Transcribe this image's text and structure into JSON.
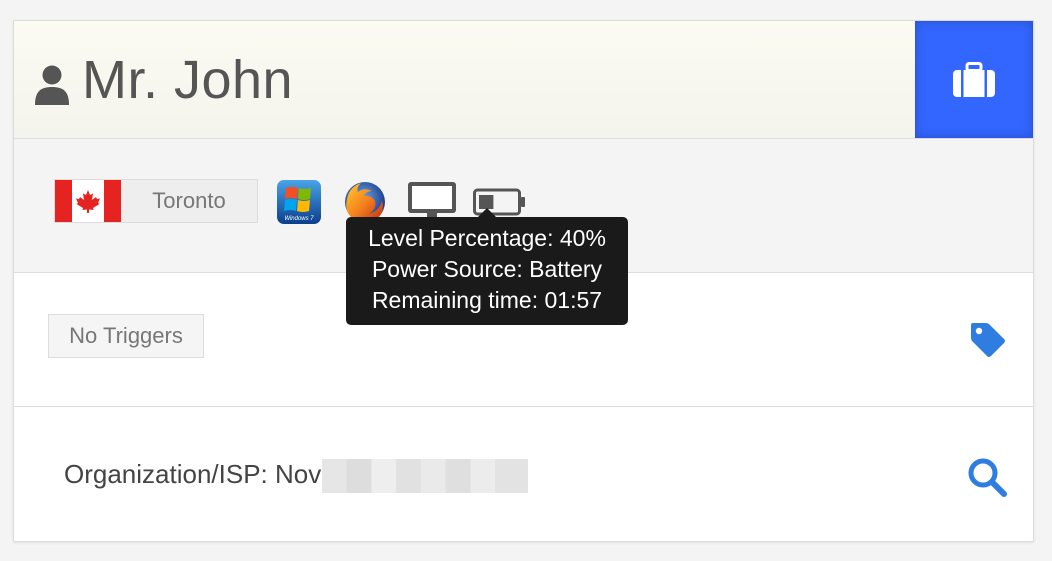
{
  "header": {
    "name": "Mr. John",
    "user_icon": "user-icon",
    "case_button_icon": "briefcase-icon"
  },
  "location": {
    "country_flag": "canada-flag-icon",
    "city": "Toronto"
  },
  "device_icons": [
    "windows7-icon",
    "firefox-icon",
    "desktop-icon",
    "battery-icon"
  ],
  "battery": {
    "level_percent": 40
  },
  "tooltip": {
    "line1": "Level Percentage: 40%",
    "line2": "Power Source: Battery",
    "line3": "Remaining time: 01:57"
  },
  "triggers": {
    "label": "No Triggers",
    "icon": "tag-icon"
  },
  "organization": {
    "label": "Organization/ISP: Nov",
    "icon": "search-icon"
  },
  "colors": {
    "accent": "#3366ff",
    "icon_blue": "#2f7de1",
    "tooltip_bg": "#1a1a1a"
  }
}
